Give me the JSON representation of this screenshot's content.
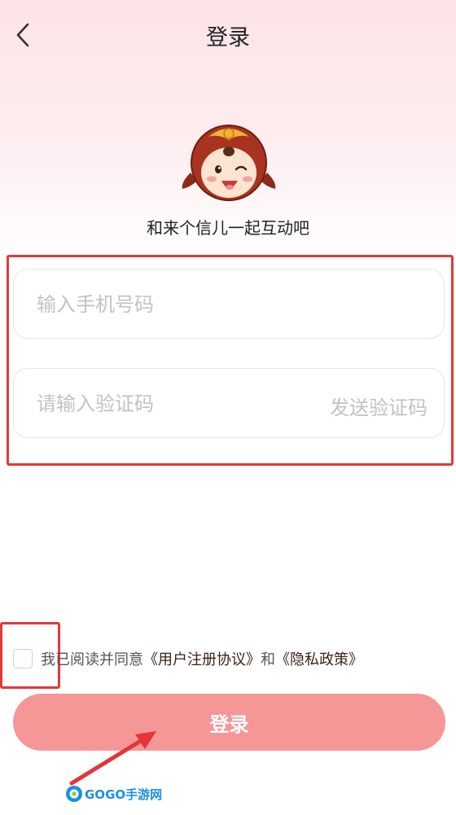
{
  "header": {
    "title": "登录"
  },
  "slogan": "和来个信儿一起互动吧",
  "form": {
    "phone_placeholder": "输入手机号码",
    "code_placeholder": "请输入验证码",
    "send_code_label": "发送验证码"
  },
  "agreement": {
    "prefix": "我已阅读并同意",
    "user_agreement": "《用户注册协议》",
    "and": "和",
    "privacy_policy": "《隐私政策》"
  },
  "login_button_label": "登录",
  "watermark": "GOGO手游网",
  "colors": {
    "accent": "#f59797",
    "highlight": "#e03a3a",
    "link": "#3a2218"
  }
}
